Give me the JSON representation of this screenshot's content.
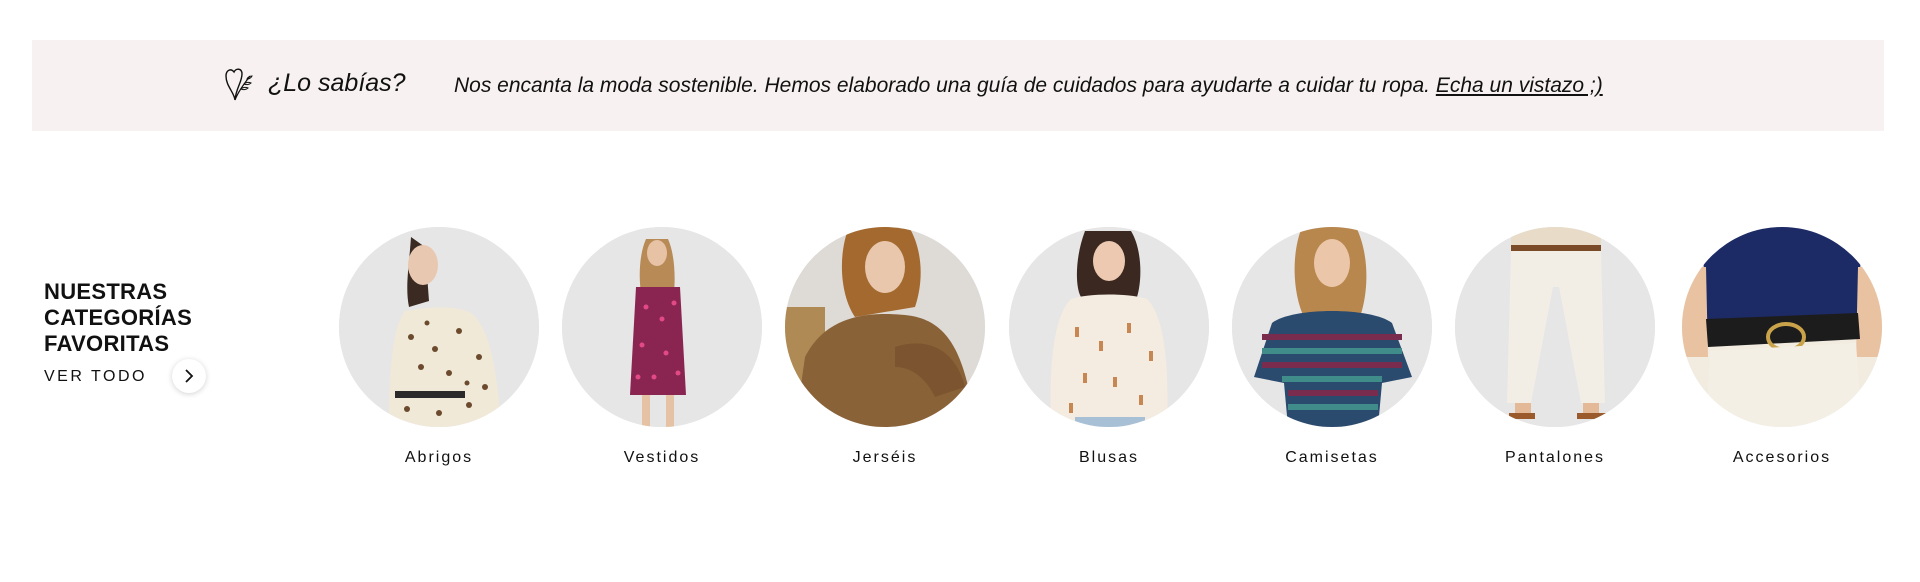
{
  "banner": {
    "icon": "heart-leaf-icon",
    "title": "¿Lo sabías?",
    "text": "Nos encanta la moda sostenible. Hemos elaborado una guía de cuidados para ayudarte a cuidar tu ropa.",
    "link": "Echa un vistazo ;)",
    "background": "#f7f2f1"
  },
  "favorites": {
    "title_line1": "NUESTRAS",
    "title_line2": "CATEGORÍAS",
    "title_line3": "FAVORITAS",
    "see_all": "VER TODO",
    "see_all_icon": "chevron-right-icon"
  },
  "categories": [
    {
      "label": "Abrigos"
    },
    {
      "label": "Vestidos"
    },
    {
      "label": "Jerséis"
    },
    {
      "label": "Blusas"
    },
    {
      "label": "Camisetas"
    },
    {
      "label": "Pantalones"
    },
    {
      "label": "Accesorios"
    }
  ]
}
